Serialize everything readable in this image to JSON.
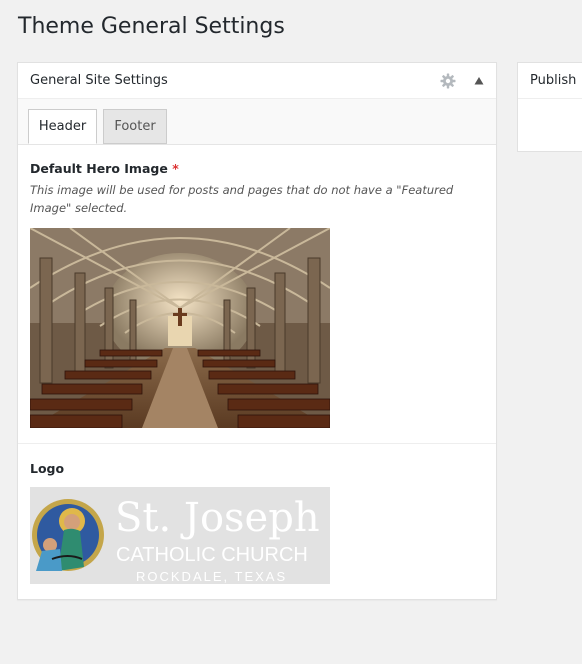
{
  "page": {
    "title": "Theme General Settings"
  },
  "postbox": {
    "title": "General Site Settings",
    "icons": {
      "settings": "gear-icon",
      "collapse": "triangle-up-icon"
    },
    "tabs": [
      {
        "label": "Header",
        "active": true
      },
      {
        "label": "Footer",
        "active": false
      }
    ],
    "fields": {
      "hero": {
        "label": "Default Hero Image",
        "required_mark": "*",
        "description": "This image will be used for posts and pages that do not have a \"Featured Image\" selected."
      },
      "logo": {
        "label": "Logo",
        "image_text": {
          "name": "St. Joseph",
          "line2": "CATHOLIC CHURCH",
          "line3": "ROCKDALE, TEXAS"
        }
      }
    }
  },
  "publish": {
    "title": "Publish"
  },
  "colors": {
    "background": "#f1f1f1",
    "panel": "#ffffff",
    "required": "#dc3232",
    "logo_bg": "#e2e2e2"
  }
}
